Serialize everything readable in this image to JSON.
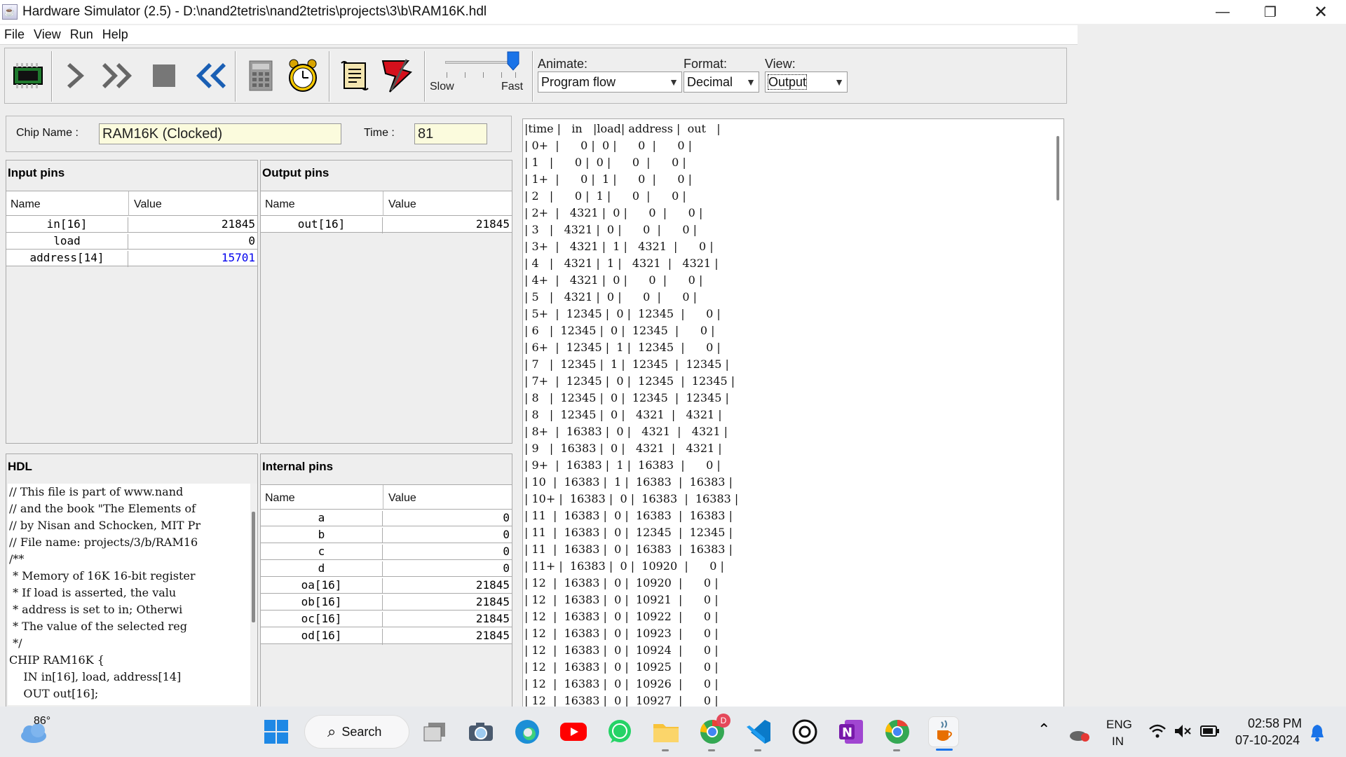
{
  "window": {
    "title": "Hardware Simulator (2.5) - D:\\nand2tetris\\nand2tetris\\projects\\3\\b\\RAM16K.hdl",
    "controls": [
      "minimize",
      "restore",
      "close"
    ]
  },
  "menu": [
    "File",
    "View",
    "Run",
    "Help"
  ],
  "toolbar": {
    "buttons": [
      {
        "name": "load-chip",
        "icon": "chip-icon"
      },
      {
        "name": "single-step",
        "icon": "step-icon"
      },
      {
        "name": "run",
        "icon": "fast-forward-icon"
      },
      {
        "name": "stop",
        "icon": "stop-icon"
      },
      {
        "name": "reset",
        "icon": "rewind-icon"
      },
      {
        "name": "eval",
        "icon": "calculator-icon"
      },
      {
        "name": "tick-tock",
        "icon": "clock-icon"
      },
      {
        "name": "load-script",
        "icon": "script-icon"
      },
      {
        "name": "breakpoints",
        "icon": "flag-icon"
      }
    ],
    "slider": {
      "slow_label": "Slow",
      "fast_label": "Fast",
      "speed_fraction": 0.95
    },
    "animate": {
      "label": "Animate:",
      "value": "Program flow"
    },
    "format": {
      "label": "Format:",
      "value": "Decimal"
    },
    "view": {
      "label": "View:",
      "value": "Output"
    }
  },
  "chip": {
    "name_label": "Chip Name :",
    "name_value": "RAM16K (Clocked)",
    "time_label": "Time :",
    "time_value": "81"
  },
  "input_pins": {
    "title": "Input pins",
    "col_name": "Name",
    "col_value": "Value",
    "rows": [
      {
        "name": "in[16]",
        "value": "21845"
      },
      {
        "name": "load",
        "value": "0"
      },
      {
        "name": "address[14]",
        "value": "15701"
      }
    ],
    "highlight_color": "#0000ee"
  },
  "output_pins": {
    "title": "Output pins",
    "col_name": "Name",
    "col_value": "Value",
    "rows": [
      {
        "name": "out[16]",
        "value": "21845"
      }
    ]
  },
  "hdl": {
    "title": "HDL",
    "lines": [
      "// This file is part of www.nand",
      "// and the book \"The Elements of",
      "// by Nisan and Schocken, MIT Pr",
      "// File name: projects/3/b/RAM16",
      "/**",
      " * Memory of 16K 16-bit register",
      " * If load is asserted, the valu",
      " * address is set to in; Otherwi",
      " * The value of the selected reg",
      " */",
      "CHIP RAM16K {",
      "    IN in[16], load, address[14]",
      "    OUT out[16];"
    ]
  },
  "internal_pins": {
    "title": "Internal pins",
    "col_name": "Name",
    "col_value": "Value",
    "rows": [
      {
        "name": "a",
        "value": "0"
      },
      {
        "name": "b",
        "value": "0"
      },
      {
        "name": "c",
        "value": "0"
      },
      {
        "name": "d",
        "value": "0"
      },
      {
        "name": "oa[16]",
        "value": "21845"
      },
      {
        "name": "ob[16]",
        "value": "21845"
      },
      {
        "name": "oc[16]",
        "value": "21845"
      },
      {
        "name": "od[16]",
        "value": "21845"
      }
    ]
  },
  "output_file": {
    "lines": [
      "|time |   in   |load| address |  out   |",
      "| 0+  |      0 |  0 |      0  |      0 |",
      "| 1   |      0 |  0 |      0  |      0 |",
      "| 1+  |      0 |  1 |      0  |      0 |",
      "| 2   |      0 |  1 |      0  |      0 |",
      "| 2+  |   4321 |  0 |      0  |      0 |",
      "| 3   |   4321 |  0 |      0  |      0 |",
      "| 3+  |   4321 |  1 |   4321  |      0 |",
      "| 4   |   4321 |  1 |   4321  |   4321 |",
      "| 4+  |   4321 |  0 |      0  |      0 |",
      "| 5   |   4321 |  0 |      0  |      0 |",
      "| 5+  |  12345 |  0 |  12345  |      0 |",
      "| 6   |  12345 |  0 |  12345  |      0 |",
      "| 6+  |  12345 |  1 |  12345  |      0 |",
      "| 7   |  12345 |  1 |  12345  |  12345 |",
      "| 7+  |  12345 |  0 |  12345  |  12345 |",
      "| 8   |  12345 |  0 |  12345  |  12345 |",
      "| 8   |  12345 |  0 |   4321  |   4321 |",
      "| 8+  |  16383 |  0 |   4321  |   4321 |",
      "| 9   |  16383 |  0 |   4321  |   4321 |",
      "| 9+  |  16383 |  1 |  16383  |      0 |",
      "| 10  |  16383 |  1 |  16383  |  16383 |",
      "| 10+ |  16383 |  0 |  16383  |  16383 |",
      "| 11  |  16383 |  0 |  16383  |  16383 |",
      "| 11  |  16383 |  0 |  12345  |  12345 |",
      "| 11  |  16383 |  0 |  16383  |  16383 |",
      "| 11+ |  16383 |  0 |  10920  |      0 |",
      "| 12  |  16383 |  0 |  10920  |      0 |",
      "| 12  |  16383 |  0 |  10921  |      0 |",
      "| 12  |  16383 |  0 |  10922  |      0 |",
      "| 12  |  16383 |  0 |  10923  |      0 |",
      "| 12  |  16383 |  0 |  10924  |      0 |",
      "| 12  |  16383 |  0 |  10925  |      0 |",
      "| 12  |  16383 |  0 |  10926  |      0 |",
      "| 12  |  16383 |  0 |  10927  |      0 |"
    ]
  },
  "taskbar": {
    "weather_temp": "86°",
    "search_label": "Search",
    "lang_top": "ENG",
    "lang_bottom": "IN",
    "time": "02:58 PM",
    "date": "07-10-2024",
    "chrome_badge": "D",
    "apps": [
      "task-view-icon",
      "camera-icon",
      "edge-icon",
      "youtube-icon",
      "whatsapp-icon",
      "file-explorer-icon",
      "chrome-icon",
      "vscode-icon",
      "chatgpt-icon",
      "onenote-icon",
      "chrome-alt-icon",
      "java-icon"
    ]
  }
}
